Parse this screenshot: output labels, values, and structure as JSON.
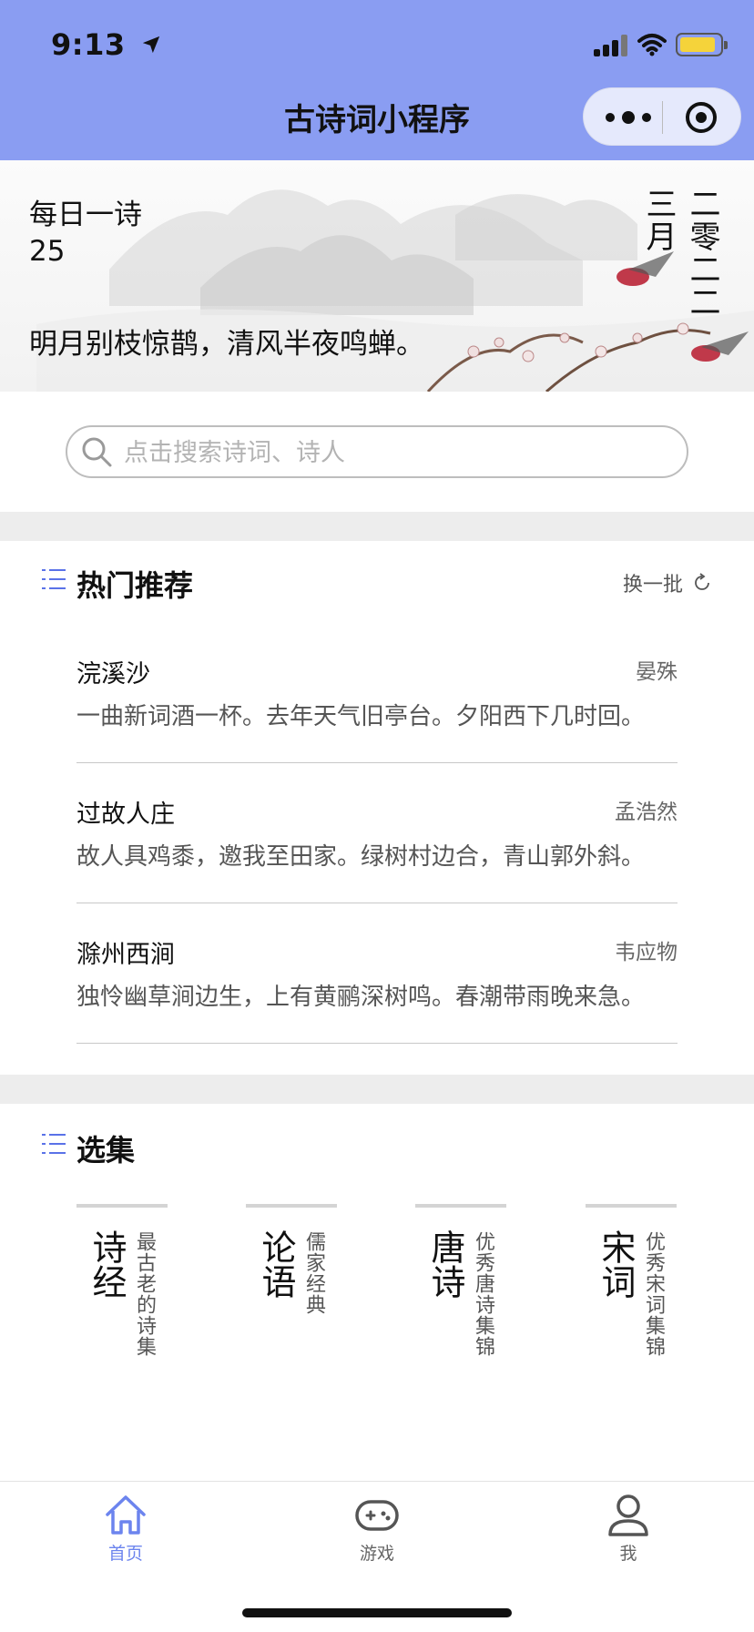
{
  "status_bar": {
    "time": "9:13"
  },
  "nav": {
    "title": "古诗词小程序"
  },
  "daily": {
    "title": "每日一诗",
    "day": "25",
    "line": "明月别枝惊鹊，清风半夜鸣蝉。",
    "month": "三月",
    "year": "二零二二"
  },
  "search": {
    "placeholder": "点击搜索诗词、诗人"
  },
  "hot": {
    "title": "热门推荐",
    "refresh_label": "换一批",
    "items": [
      {
        "title": "浣溪沙",
        "author": "晏殊",
        "excerpt": "一曲新词酒一杯。去年天气旧亭台。夕阳西下几时回。"
      },
      {
        "title": "过故人庄",
        "author": "孟浩然",
        "excerpt": "故人具鸡黍，邀我至田家。绿树村边合，青山郭外斜。"
      },
      {
        "title": "滁州西涧",
        "author": "韦应物",
        "excerpt": "独怜幽草涧边生，上有黄鹂深树鸣。春潮带雨晚来急。"
      }
    ]
  },
  "collections": {
    "title": "选集",
    "items": [
      {
        "name": "诗经",
        "desc": "最古老的诗集"
      },
      {
        "name": "论语",
        "desc": "儒家经典"
      },
      {
        "name": "唐诗",
        "desc": "优秀唐诗集锦"
      },
      {
        "name": "宋词",
        "desc": "优秀宋词集锦"
      }
    ]
  },
  "tabbar": {
    "items": [
      {
        "label": "首页",
        "icon": "home-icon",
        "active": true
      },
      {
        "label": "游戏",
        "icon": "gamepad-icon",
        "active": false
      },
      {
        "label": "我",
        "icon": "user-icon",
        "active": false
      }
    ]
  },
  "colors": {
    "header_bg": "#8a9df2",
    "accent": "#6c84ee",
    "battery": "#f5d33a"
  }
}
